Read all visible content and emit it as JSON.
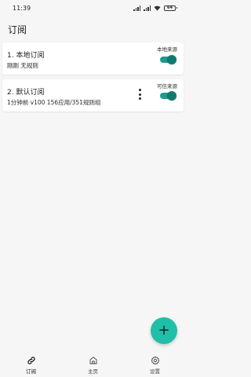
{
  "status_bar": {
    "time": "11:39",
    "battery": "64"
  },
  "app_bar": {
    "title": "订阅"
  },
  "subscriptions": [
    {
      "title": "1. 本地订阅",
      "subtitle": "刚刚   无规则",
      "tag": "本地来源",
      "enabled": true
    },
    {
      "title": "2. 默认订阅",
      "subtitle": "1分钟前   v100   156应用/351规则组",
      "tag": "可信来源",
      "enabled": true
    }
  ],
  "fab": {
    "icon": "plus-icon",
    "symbol": "+"
  },
  "bottom_nav": {
    "items": [
      {
        "label": "订阅",
        "icon": "link-icon",
        "active": true
      },
      {
        "label": "主页",
        "icon": "home-icon",
        "active": false
      },
      {
        "label": "设置",
        "icon": "gear-icon",
        "active": false
      }
    ]
  },
  "colors": {
    "accent": "#1fbfa8",
    "switch_track": "#1e9b8c",
    "switch_thumb": "#117a70",
    "background": "#f6f6f6"
  }
}
